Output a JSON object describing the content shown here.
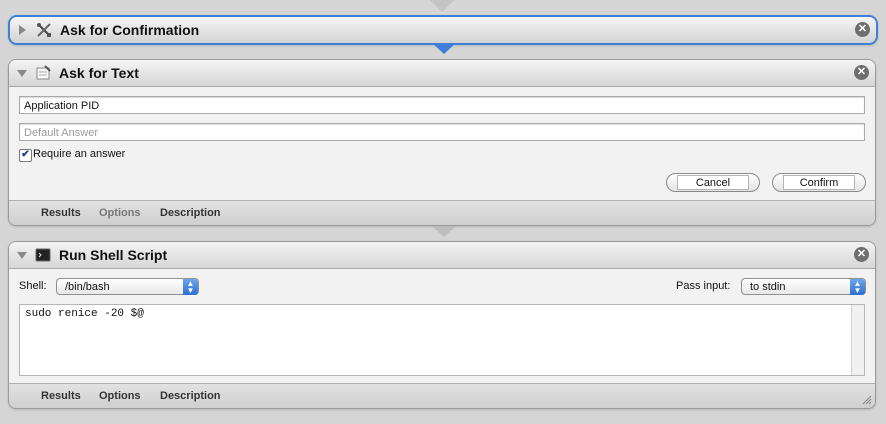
{
  "actions": [
    {
      "title": "Ask for Confirmation",
      "icon": "confirmation-tools-icon",
      "collapsed": true
    },
    {
      "title": "Ask for Text",
      "icon": "notepad-icon",
      "question_value": "Application PID",
      "default_answer_placeholder": "Default Answer",
      "require_answer_label": "Require an answer",
      "require_answer_checked": true,
      "cancel_label": "Cancel",
      "confirm_label": "Confirm",
      "footer_tabs": [
        "Results",
        "Options",
        "Description"
      ]
    },
    {
      "title": "Run Shell Script",
      "icon": "terminal-icon",
      "shell_label": "Shell:",
      "shell_value": "/bin/bash",
      "pass_input_label": "Pass input:",
      "pass_input_value": "to stdin",
      "script": "sudo renice -20 $@",
      "footer_tabs": [
        "Results",
        "Options",
        "Description"
      ]
    }
  ],
  "close_glyph": "✕",
  "checkmark_glyph": "✔",
  "colors": {
    "selection_border": "#3f7fd8",
    "popup_accent": "#2b6fd0"
  }
}
